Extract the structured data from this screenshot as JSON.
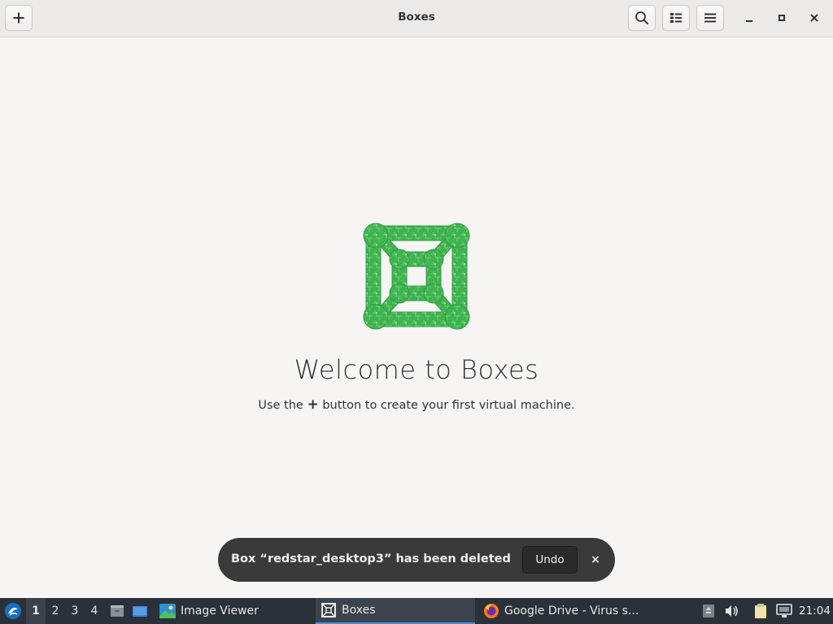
{
  "window": {
    "title": "Boxes",
    "add_icon": "plus-icon",
    "search_icon": "search-icon",
    "view_icon": "list-view-icon",
    "menu_icon": "hamburger-menu-icon",
    "minimize_icon": "minimize-icon",
    "maximize_icon": "maximize-icon",
    "close_icon": "close-icon"
  },
  "empty_state": {
    "heading": "Welcome to Boxes",
    "hint_prefix": "Use the",
    "hint_symbol": "+",
    "hint_suffix": "button to create your first virtual machine.",
    "logo": "boxes-logo",
    "logo_color": "#3fb34f"
  },
  "toast": {
    "message": "Box “redstar_desktop3” has been deleted",
    "undo_label": "Undo",
    "close_label": "×"
  },
  "taskbar": {
    "start_icon": "lubuntu-start-icon",
    "workspaces": [
      "1",
      "2",
      "3",
      "4"
    ],
    "active_workspace": "1",
    "launchers": [
      "file-manager-icon",
      "desktop-icon"
    ],
    "tasks": [
      {
        "label": "Image Viewer",
        "icon": "image-viewer-icon",
        "active": false
      },
      {
        "label": "Boxes",
        "icon": "boxes-icon",
        "active": true
      },
      {
        "label": "Google Drive - Virus s...",
        "icon": "firefox-icon",
        "active": false
      }
    ],
    "tray": [
      "removable-media-icon",
      "volume-icon",
      "clipboard-icon",
      "network-icon"
    ],
    "clock": "21:04",
    "accent": "#4a90d9"
  }
}
